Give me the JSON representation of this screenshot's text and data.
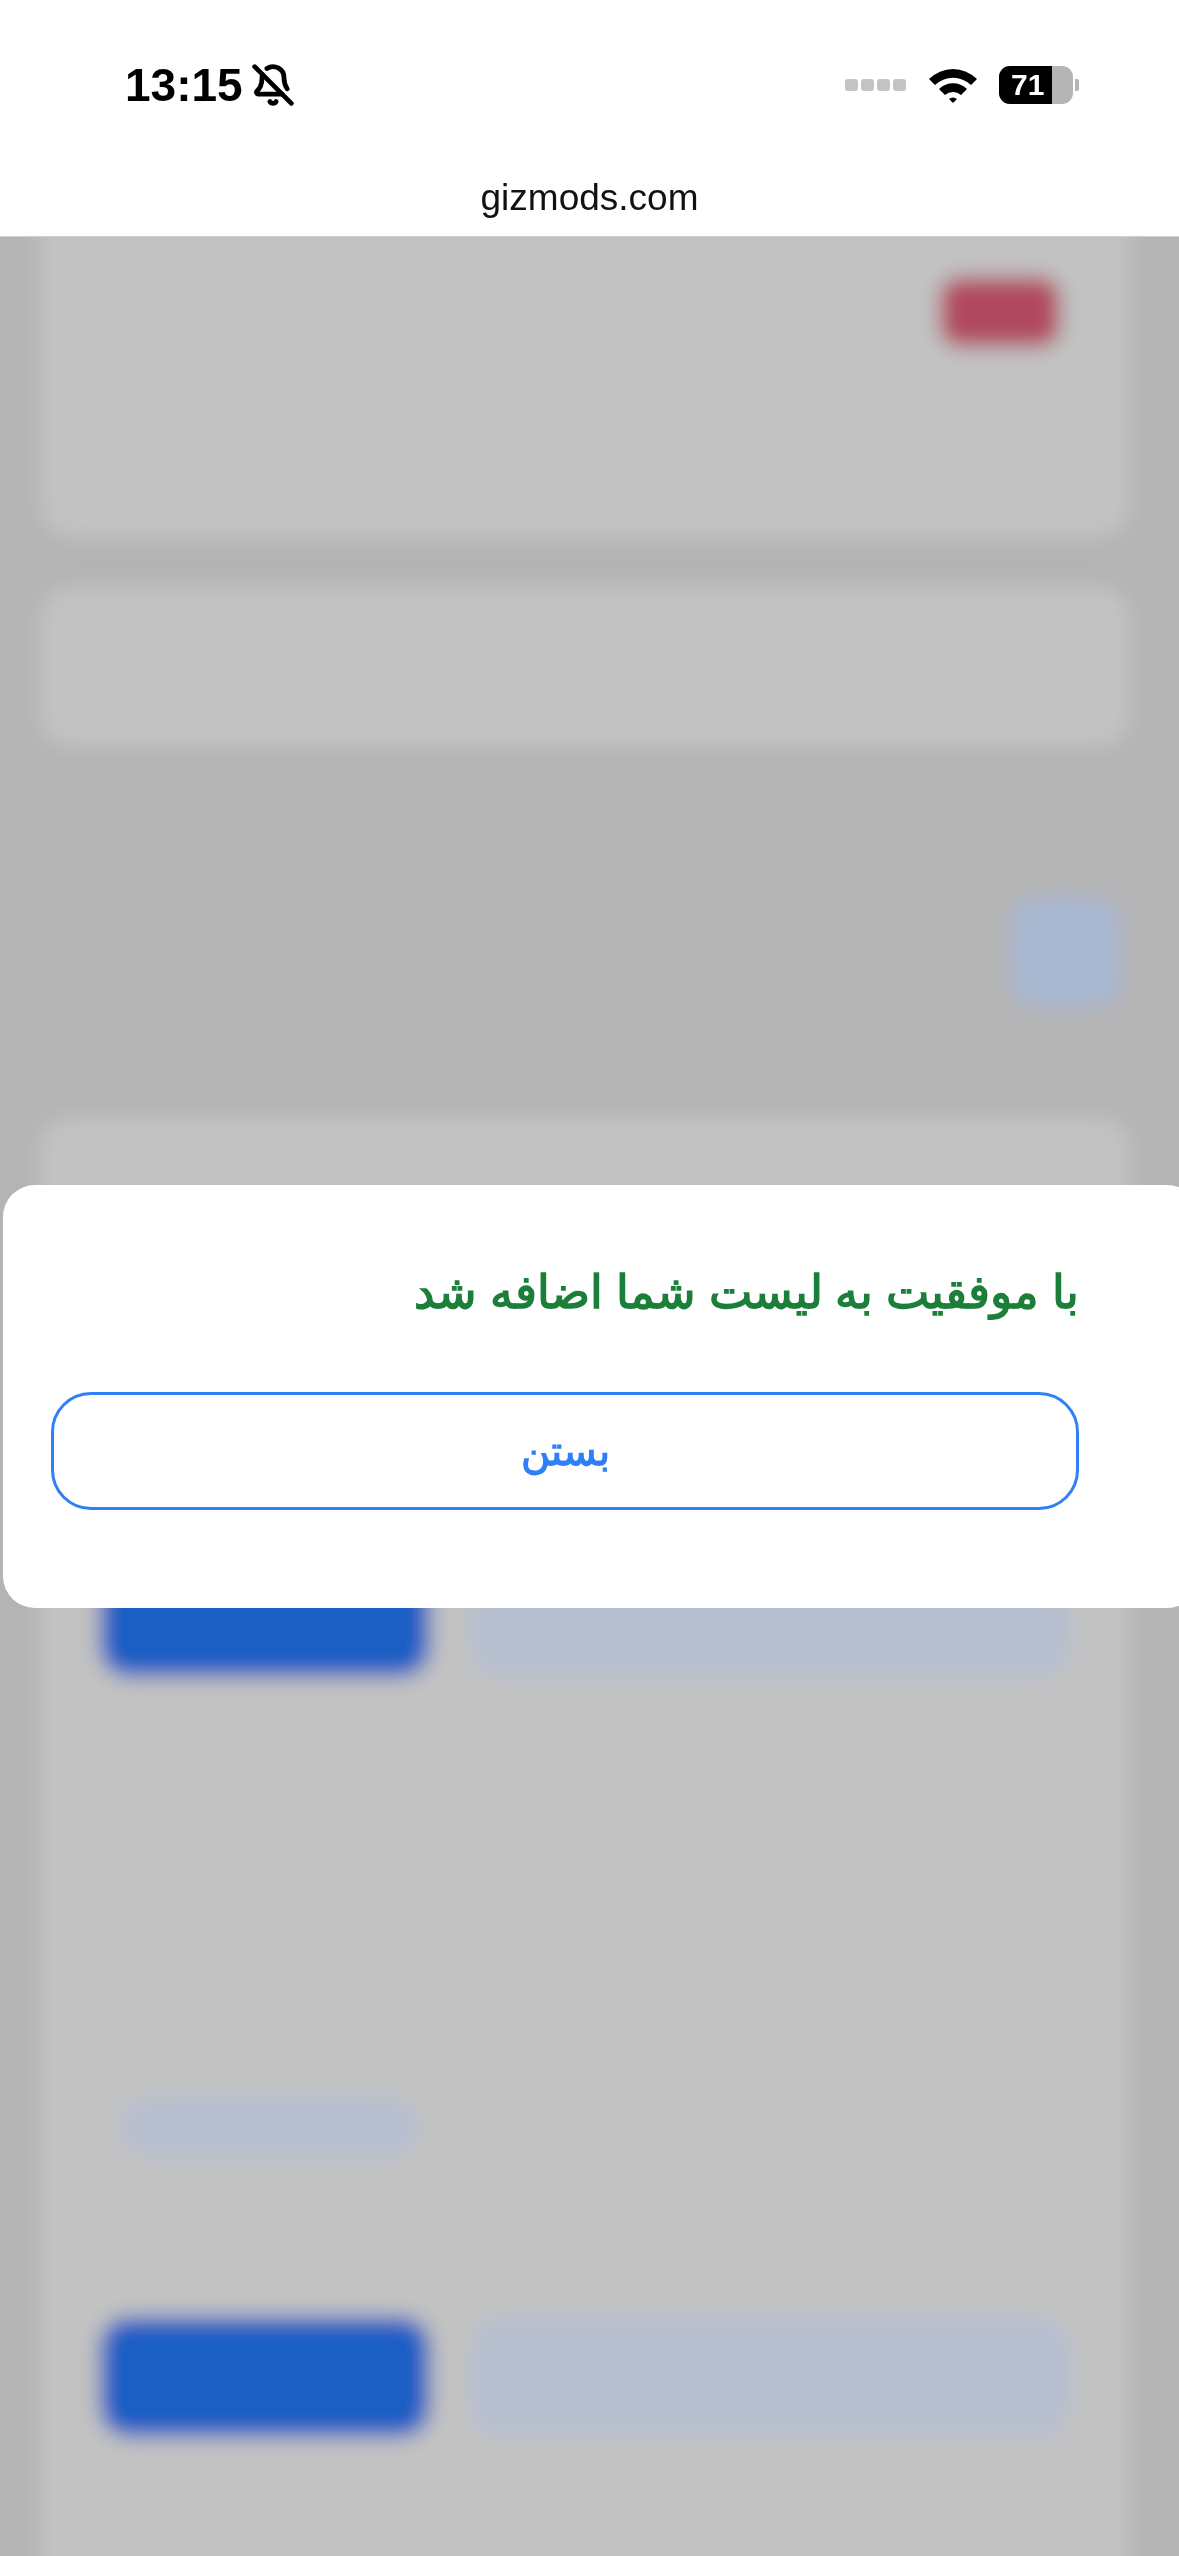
{
  "status_bar": {
    "time": "13:15",
    "battery": "71"
  },
  "address_bar": {
    "url": "gizmods.com"
  },
  "dialog": {
    "message": "با موفقیت به لیست شما اضافه شد",
    "buttons": [
      "بستن"
    ]
  }
}
